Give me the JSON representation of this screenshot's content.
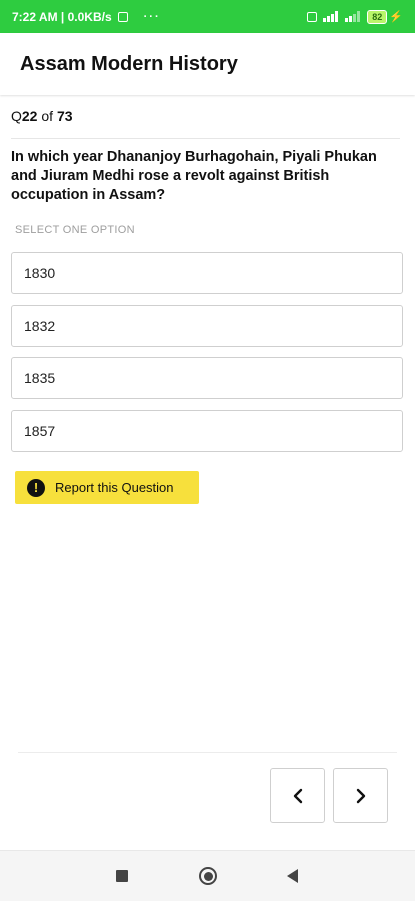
{
  "status_bar": {
    "time_and_speed": "7:22 AM | 0.0KB/s",
    "dots": "···",
    "battery_level": "82"
  },
  "header": {
    "title": "Assam Modern History"
  },
  "counter": {
    "prefix": "Q",
    "current": "22",
    "of_word": " of ",
    "total": "73"
  },
  "question": {
    "text": "In which year Dhananjoy Burhagohain, Piyali Phukan and Jiuram Medhi rose a revolt against British occupation in Assam?"
  },
  "options_label": "SELECT ONE OPTION",
  "options": [
    {
      "label": "1830"
    },
    {
      "label": "1832"
    },
    {
      "label": "1835"
    },
    {
      "label": "1857"
    }
  ],
  "report": {
    "icon_glyph": "!",
    "label": "Report this Question",
    "bg_color": "#f7e03c"
  },
  "colors": {
    "status_bar": "#2ecc40"
  },
  "icons": {
    "prev": "chevron-left-icon",
    "next": "chevron-right-icon"
  }
}
